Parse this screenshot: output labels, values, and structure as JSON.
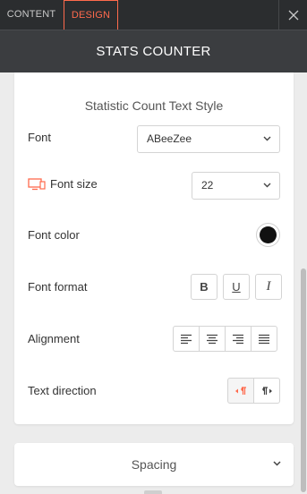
{
  "tabs": {
    "content": "CONTENT",
    "design": "DESIGN"
  },
  "header": {
    "title": "STATS COUNTER"
  },
  "section": {
    "title": "Statistic Count Text Style"
  },
  "font": {
    "label": "Font",
    "value": "ABeeZee"
  },
  "font_size": {
    "label": "Font size",
    "value": "22",
    "device_icon": "desktop-icon",
    "accent": "#ff6a4d"
  },
  "font_color": {
    "label": "Font color",
    "value": "#111111"
  },
  "font_format": {
    "label": "Font format",
    "buttons": [
      "B",
      "U",
      "I"
    ]
  },
  "alignment": {
    "label": "Alignment",
    "options": [
      "align-left",
      "align-center",
      "align-right",
      "justify"
    ]
  },
  "text_direction": {
    "label": "Text direction",
    "options": [
      "ltr",
      "rtl"
    ],
    "selected": "ltr"
  },
  "spacing": {
    "label": "Spacing"
  },
  "colors": {
    "accent": "#ff6a4d",
    "header_bg": "#3b3d40",
    "tabs_bg": "#2b2d2f"
  }
}
